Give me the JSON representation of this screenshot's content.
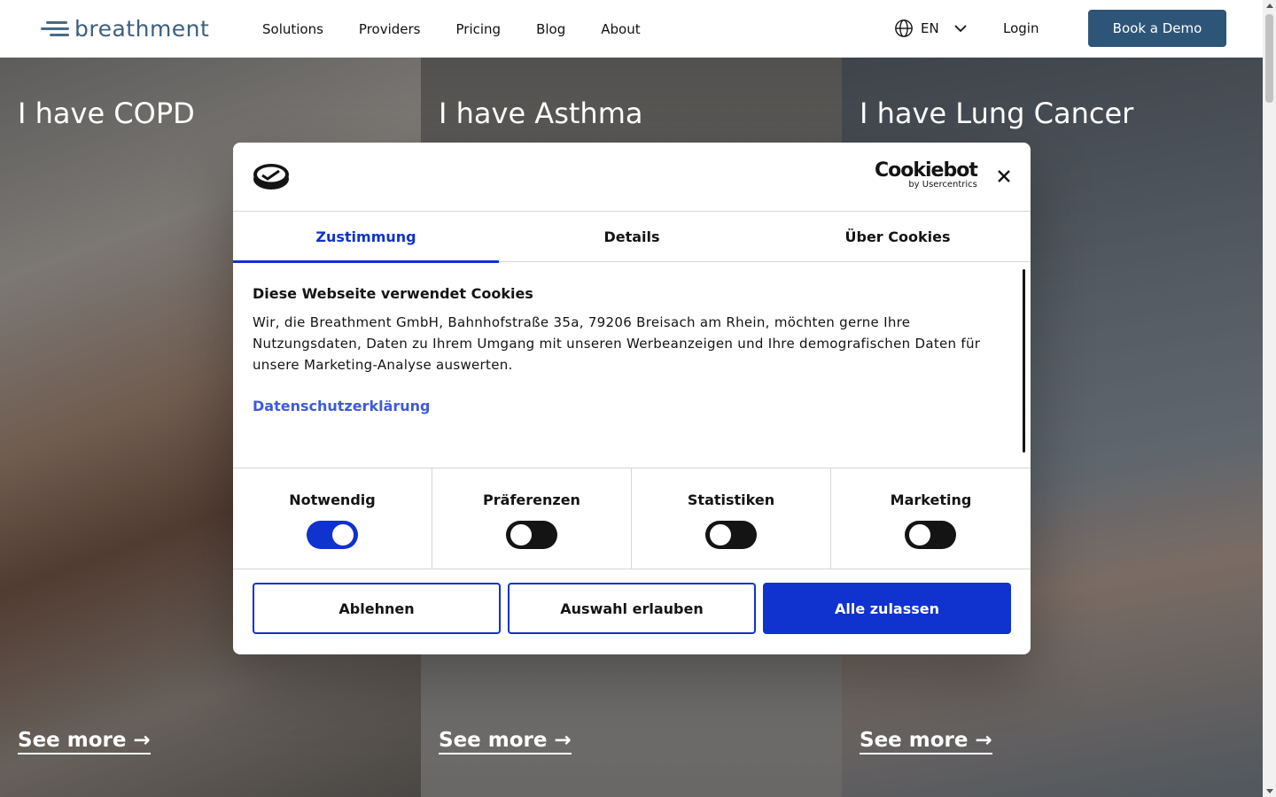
{
  "header": {
    "logo_text": "breathment",
    "nav": [
      "Solutions",
      "Providers",
      "Pricing",
      "Blog",
      "About"
    ],
    "language": "EN",
    "login": "Login",
    "cta": "Book a Demo"
  },
  "hero": {
    "panels": [
      {
        "title": "I have COPD",
        "link": "See more →"
      },
      {
        "title": "I have Asthma",
        "link": "See more →"
      },
      {
        "title": "I have Lung Cancer",
        "link": "See more →"
      }
    ]
  },
  "cookie": {
    "brand": "Cookiebot",
    "brand_sub": "by Usercentrics",
    "tabs": [
      "Zustimmung",
      "Details",
      "Über Cookies"
    ],
    "heading": "Diese Webseite verwendet Cookies",
    "text": "Wir, die Breathment GmbH, Bahnhofstraße 35a, 79206 Breisach am Rhein, möchten gerne Ihre Nutzungsdaten, Daten zu Ihrem Umgang mit unseren Werbeanzeigen und Ihre demografischen Daten für unsere Marketing-Analyse auswerten.",
    "policy_link": "Datenschutzerklärung",
    "toggles": [
      {
        "label": "Notwendig",
        "on": true
      },
      {
        "label": "Präferenzen",
        "on": false
      },
      {
        "label": "Statistiken",
        "on": false
      },
      {
        "label": "Marketing",
        "on": false
      }
    ],
    "buttons": {
      "deny": "Ablehnen",
      "selection": "Auswahl erlauben",
      "allow_all": "Alle zulassen"
    },
    "accent_color": "#1032cf"
  }
}
